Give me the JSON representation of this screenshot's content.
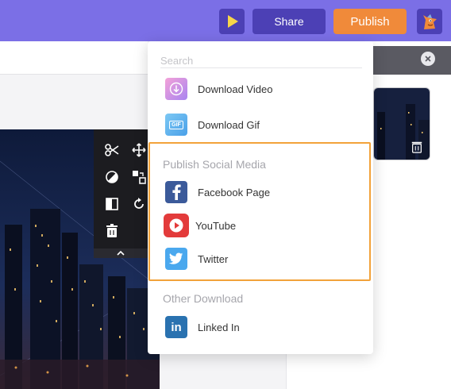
{
  "topbar": {
    "share_label": "Share",
    "publish_label": "Publish",
    "colors": {
      "bar": "#7b6fe6",
      "button": "#4c40b5",
      "publish": "#f08a3a",
      "play": "#f7d54a"
    }
  },
  "dropdown": {
    "search_placeholder": "Search",
    "items_top": [
      {
        "label": "Download Video",
        "icon": "download-video-icon"
      },
      {
        "label": "Download Gif",
        "icon": "download-gif-icon"
      }
    ],
    "social_title": "Publish Social Media",
    "social_items": [
      {
        "label": "Facebook Page",
        "icon": "facebook-icon"
      },
      {
        "label": "YouTube",
        "icon": "youtube-icon"
      },
      {
        "label": "Twitter",
        "icon": "twitter-icon"
      }
    ],
    "other_title": "Other Download",
    "other_items": [
      {
        "label": "Linked In",
        "icon": "linkedin-icon"
      }
    ],
    "gif_icon_text": "GIF",
    "linkedin_icon_text": "in",
    "highlight_color": "#f2a23a"
  }
}
